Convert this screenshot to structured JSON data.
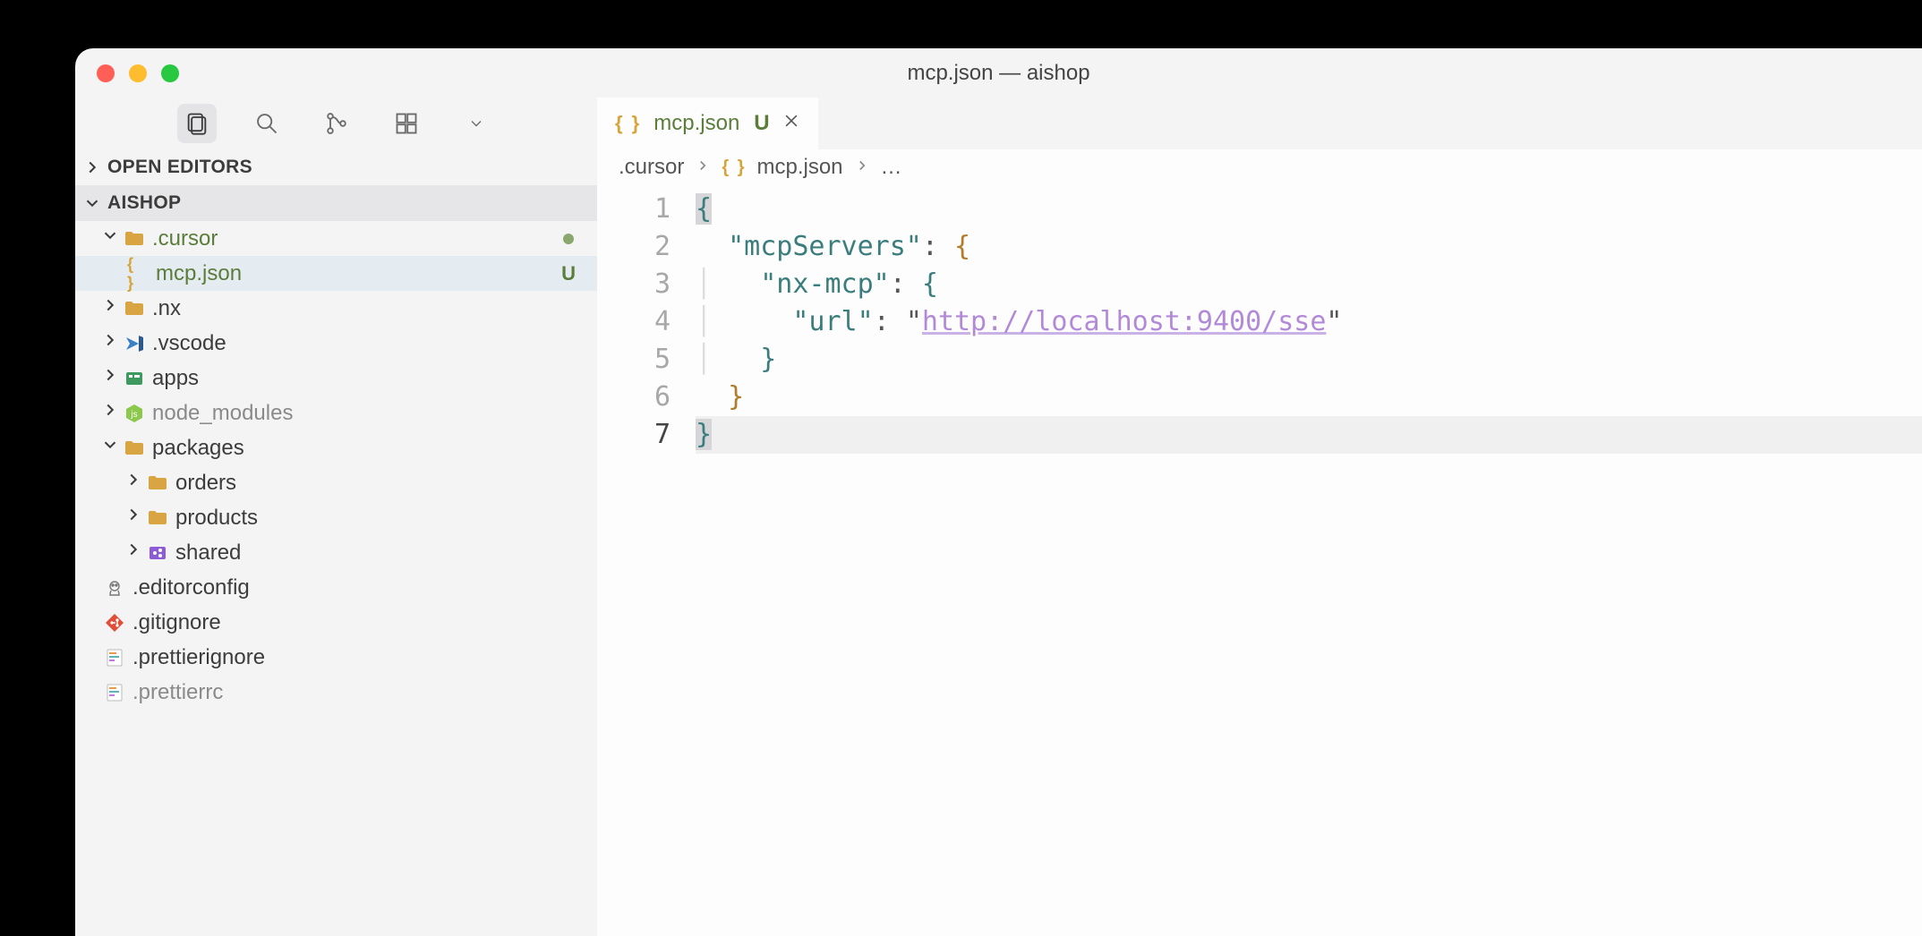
{
  "window": {
    "title": "mcp.json — aishop"
  },
  "activity": {
    "explorer_active": true
  },
  "explorer": {
    "open_editors_label": "OPEN EDITORS",
    "project_label": "AISHOP",
    "tree": [
      {
        "name": ".cursor",
        "kind": "folder",
        "depth": 0,
        "expanded": true,
        "status": "dot",
        "git": "u"
      },
      {
        "name": "mcp.json",
        "kind": "json",
        "depth": 1,
        "selected": true,
        "status": "U",
        "git": "u"
      },
      {
        "name": ".nx",
        "kind": "folder",
        "depth": 0,
        "expanded": false
      },
      {
        "name": ".vscode",
        "kind": "vscode",
        "depth": 0,
        "expanded": false
      },
      {
        "name": "apps",
        "kind": "apps",
        "depth": 0,
        "expanded": false
      },
      {
        "name": "node_modules",
        "kind": "nodemod",
        "depth": 0,
        "expanded": false,
        "dim": true
      },
      {
        "name": "packages",
        "kind": "folder",
        "depth": 0,
        "expanded": true
      },
      {
        "name": "orders",
        "kind": "folder",
        "depth": 1,
        "expanded": false
      },
      {
        "name": "products",
        "kind": "folder",
        "depth": 1,
        "expanded": false
      },
      {
        "name": "shared",
        "kind": "shared",
        "depth": 1,
        "expanded": false
      },
      {
        "name": ".editorconfig",
        "kind": "editcfg",
        "depth": 0
      },
      {
        "name": ".gitignore",
        "kind": "git",
        "depth": 0
      },
      {
        "name": ".prettierignore",
        "kind": "pretty",
        "depth": 0
      },
      {
        "name": ".prettierrc",
        "kind": "pretty",
        "depth": 0,
        "dim": true
      }
    ]
  },
  "tab": {
    "name": "mcp.json",
    "status": "U"
  },
  "breadcrumbs": {
    "seg0": ".cursor",
    "seg1": "mcp.json",
    "tail": "…"
  },
  "code": {
    "lines": [
      "1",
      "2",
      "3",
      "4",
      "5",
      "6",
      "7"
    ],
    "current_line": 7,
    "content": {
      "k_mcpServers": "\"mcpServers\"",
      "k_nxmcp": "\"nx-mcp\"",
      "k_url": "\"url\"",
      "v_url": "http://localhost:9400/sse"
    }
  }
}
